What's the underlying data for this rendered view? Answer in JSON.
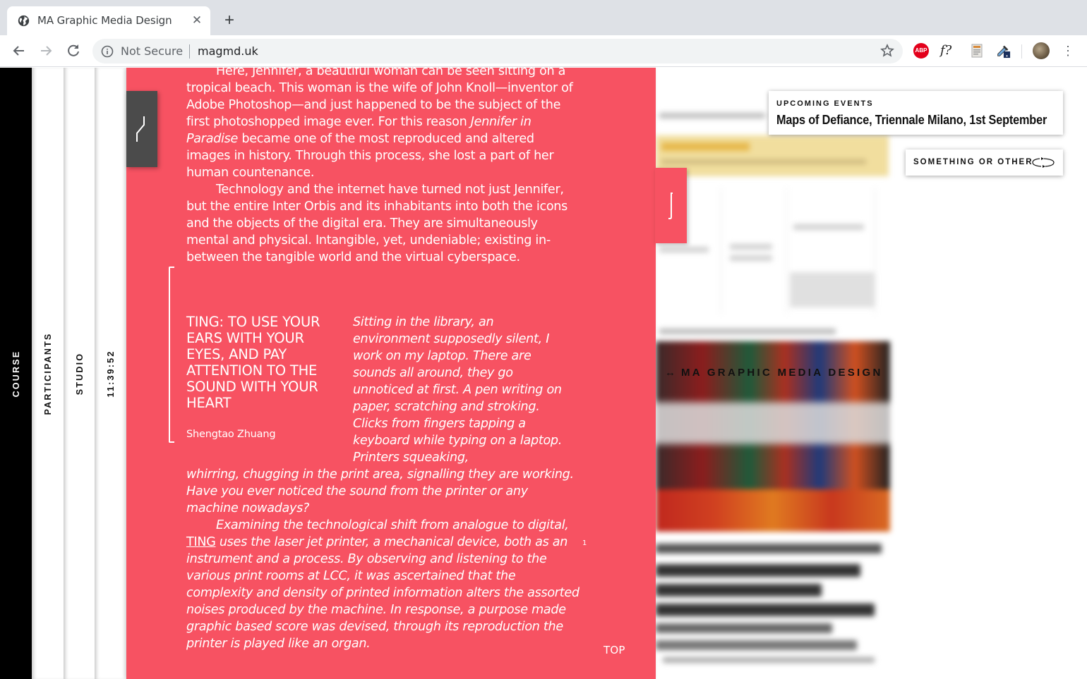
{
  "browser": {
    "tab_title": "MA Graphic Media Design",
    "security_label": "Not Secure",
    "url": "magmd.uk",
    "extensions": [
      "adblock-plus",
      "font-identifier",
      "document-extension",
      "color-picker"
    ],
    "abp_label": "ABP",
    "font_ext_label": "f?"
  },
  "nav": {
    "course": "COURSE",
    "participants": "PARTICIPANTS",
    "studio": "STUDIO",
    "clock": "11:39:52"
  },
  "events": {
    "kicker": "UPCOMING EVENTS",
    "event": "Maps of Defiance, Triennale Milano, 1st September",
    "other_label": "SOMETHING OR OTHER"
  },
  "background": {
    "caption_arrow": "↔",
    "caption": "MA GRAPHIC MEDIA DESIGN"
  },
  "article": {
    "para1_pre": "Here, Jennifer, a beautiful woman can be seen sitting on a tropical beach. This woman is the wife of John Knoll—inventor of Adobe Photoshop—and just happened to be the subject of the first photoshopped image ever. For this reason ",
    "para1_em": "Jennifer in Paradise",
    "para1_post": " became one of the most reproduced and altered images in history. Through this process, she lost a part of her human countenance.",
    "para2": "Technology and the internet have turned not just Jennifer, but the entire Inter Orbis and its inhabitants into both the icons and the objects of the digital era. They are simultaneously mental and physical. Intangible, yet, undeniable; existing in-between the tangible world and the virtual cyberspace.",
    "project_title": "TING: TO USE YOUR EARS WITH YOUR EYES, AND PAY ATTENTION TO THE SOUND WITH YOUR HEART",
    "author": "Shengtao Zhuang",
    "italic_col": "Sitting in the library, an environment supposedly silent, I work on my laptop. There are sounds all around, they go unnoticed at first. A pen writing on paper, scratching and stroking. Clicks from fingers tapping a keyboard while typing on a laptop. Printers squeaking,",
    "italic_cont": "whirring, chugging in the print area, signalling they are working. Have you ever noticed the sound from the printer or any machine nowadays?",
    "para4_pre": "Examining the technological shift from analogue to digital, ",
    "para4_link": "TING",
    "para4_post": " uses the laser jet printer, a mechanical device, both as an instrument and a process. By observing and listening to the various print rooms at LCC, it was ascertained that the complexity and density of printed information alters the assorted noises produced by the machine. In response, a purpose made graphic based score was devised, through its reproduction the printer is played like an organ.",
    "footnote": "1",
    "top_link": "TOP"
  },
  "colors": {
    "panel_red": "#f75262",
    "dark_tab": "#4b4b4b",
    "banner_yellow": "#f1de9e"
  }
}
